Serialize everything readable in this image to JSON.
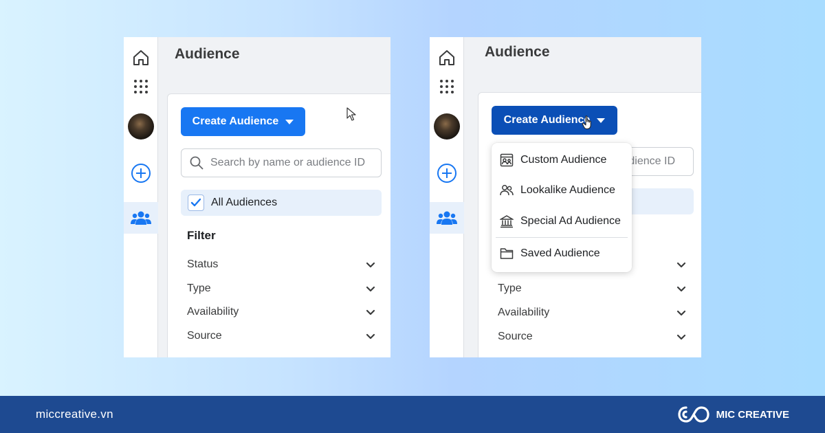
{
  "panels": [
    {
      "title": "Audience",
      "create_button": "Create Audience",
      "search_placeholder": "Search by name or audience ID",
      "all_audiences": "All Audiences",
      "filter_title": "Filter",
      "filters": [
        "Status",
        "Type",
        "Availability",
        "Source"
      ]
    },
    {
      "title": "Audience",
      "create_button": "Create Audience",
      "search_visible_fragment": "dience ID",
      "filters": [
        "Type",
        "Availability",
        "Source"
      ],
      "dropdown": {
        "items": [
          "Custom Audience",
          "Lookalike Audience",
          "Special Ad Audience",
          "Saved Audience"
        ]
      }
    }
  ],
  "footer": {
    "site": "miccreative.vn",
    "brand": "MIC CREATIVE"
  },
  "colors": {
    "accent": "#1877f2",
    "accent_pressed": "#0b4fb6",
    "footer": "#1e4a91",
    "active_nav": "#e7f0fb"
  },
  "icons": {
    "rail": [
      "home-icon",
      "apps-grid-icon",
      "avatar",
      "add-circle-icon",
      "audience-people-icon"
    ],
    "dropdown": [
      "custom-audience-icon",
      "lookalike-audience-icon",
      "special-ad-audience-icon",
      "saved-audience-folder-icon"
    ]
  }
}
